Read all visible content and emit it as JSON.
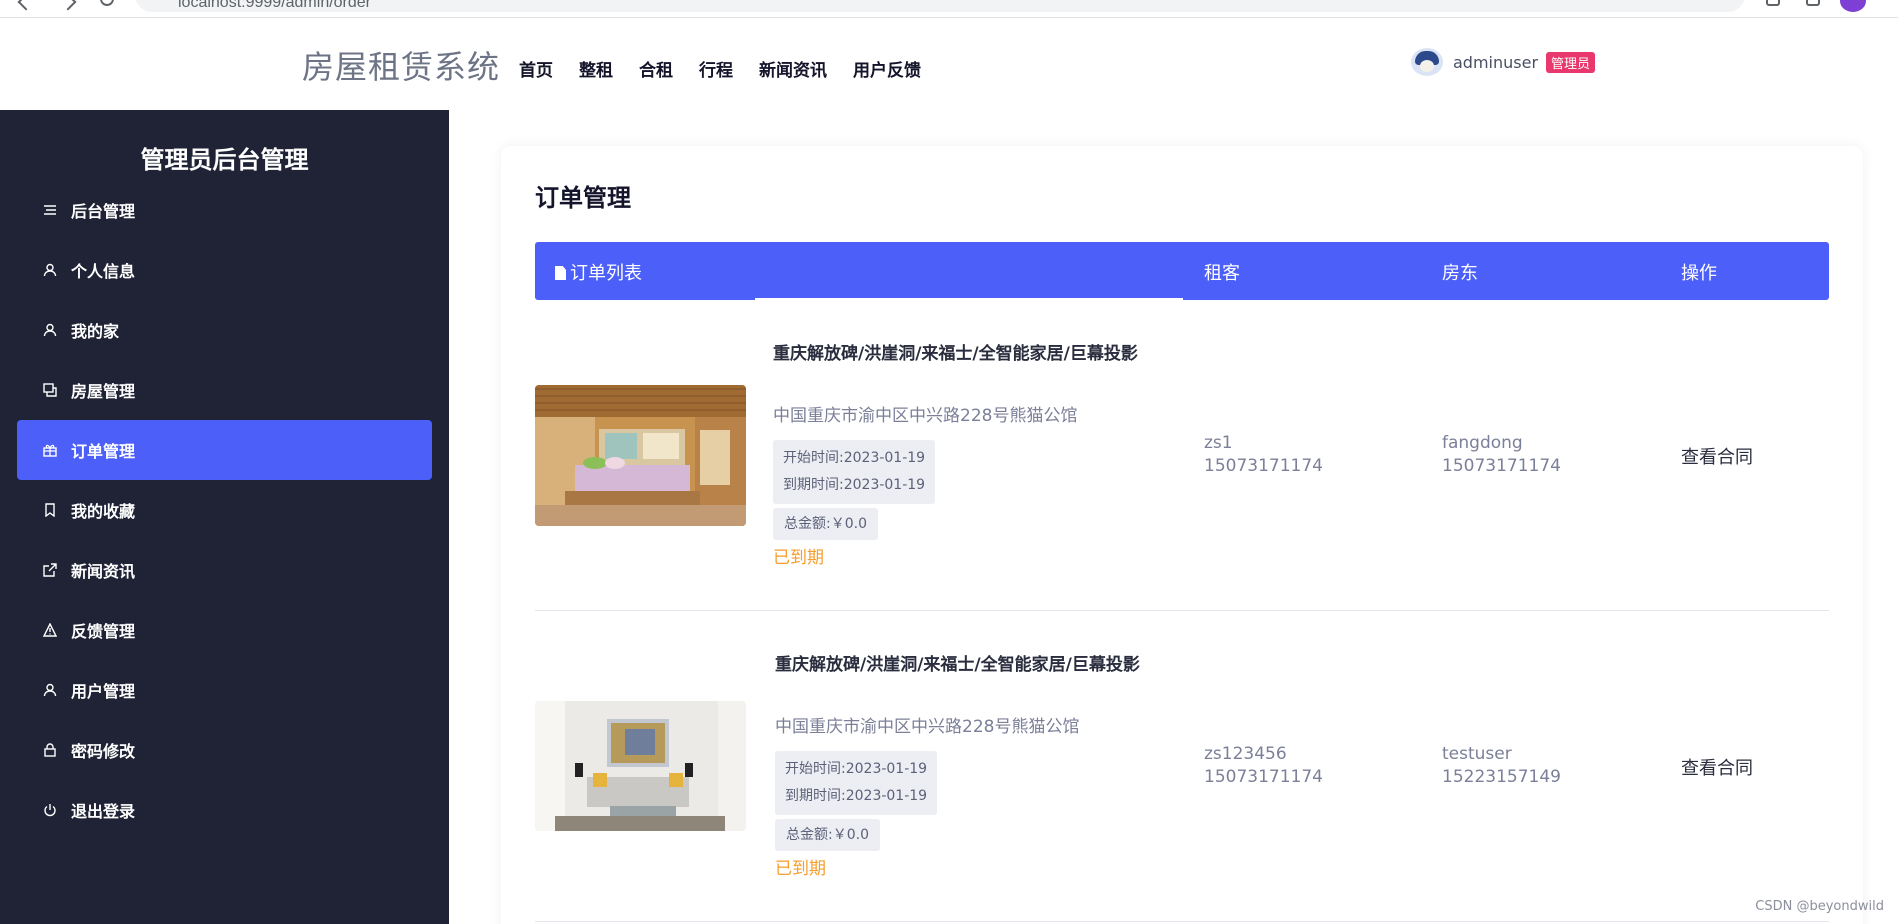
{
  "browser": {
    "url": "localhost:9999/admin/order",
    "profile_color": "#7e3fd4"
  },
  "header": {
    "brand": "房屋租赁系统",
    "nav": [
      "首页",
      "整租",
      "合租",
      "行程",
      "新闻资讯",
      "用户反馈"
    ],
    "user": {
      "name": "adminuser",
      "role": "管理员",
      "role_color": "#e8386d"
    }
  },
  "sidebar": {
    "title": "管理员后台管理",
    "active_color": "#4c5ff9",
    "background": "#1f2335",
    "items": [
      {
        "label": "后台管理",
        "icon": "menu-lines-icon",
        "active": false
      },
      {
        "label": "个人信息",
        "icon": "user-icon",
        "active": false
      },
      {
        "label": "我的家",
        "icon": "user-icon",
        "active": false
      },
      {
        "label": "房屋管理",
        "icon": "copy-icon",
        "active": false
      },
      {
        "label": "订单管理",
        "icon": "gift-icon",
        "active": true
      },
      {
        "label": "我的收藏",
        "icon": "bookmark-icon",
        "active": false
      },
      {
        "label": "新闻资讯",
        "icon": "external-link-icon",
        "active": false
      },
      {
        "label": "反馈管理",
        "icon": "warning-icon",
        "active": false
      },
      {
        "label": "用户管理",
        "icon": "user-icon",
        "active": false
      },
      {
        "label": "密码修改",
        "icon": "lock-icon",
        "active": false
      },
      {
        "label": "退出登录",
        "icon": "power-icon",
        "active": false
      }
    ]
  },
  "main": {
    "heading": "订单管理",
    "table_header": {
      "list": "订单列表",
      "tenant": "租客",
      "landlord": "房东",
      "action": "操作"
    },
    "orders": [
      {
        "title": "重庆解放碑/洪崖洞/来福士/全智能家居/巨幕投影",
        "address": "中国重庆市渝中区中兴路228号熊猫公馆",
        "start_time": "开始时间:2023-01-19",
        "end_time": "到期时间:2023-01-19",
        "amount": "总金额:￥0.0",
        "status": "已到期",
        "tenant_name": "zs1",
        "tenant_phone": "15073171174",
        "landlord_name": "fangdong",
        "landlord_phone": "15073171174",
        "action": "查看合同"
      },
      {
        "title": "重庆解放碑/洪崖洞/来福士/全智能家居/巨幕投影",
        "address": "中国重庆市渝中区中兴路228号熊猫公馆",
        "start_time": "开始时间:2023-01-19",
        "end_time": "到期时间:2023-01-19",
        "amount": "总金额:￥0.0",
        "status": "已到期",
        "tenant_name": "zs123456",
        "tenant_phone": "15073171174",
        "landlord_name": "testuser",
        "landlord_phone": "15223157149",
        "action": "查看合同"
      }
    ]
  },
  "watermark": "CSDN @beyondwild"
}
